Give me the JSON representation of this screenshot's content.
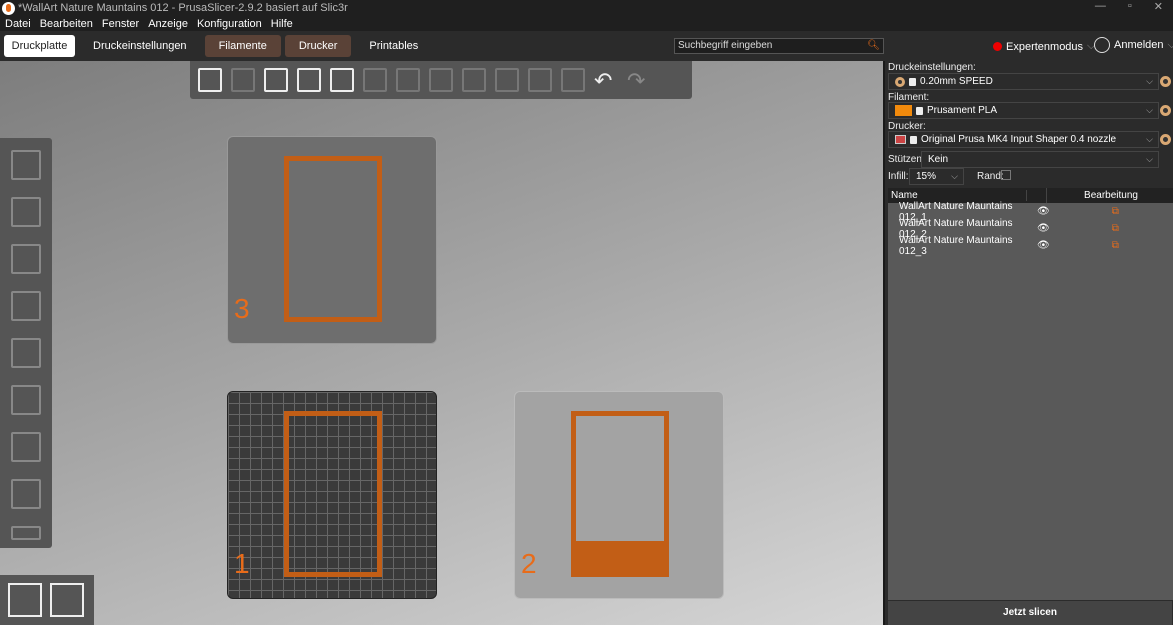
{
  "window": {
    "title": "*WallArt Nature Mauntains 012 - PrusaSlicer-2.9.2 basiert auf Slic3r"
  },
  "menu": [
    "Datei",
    "Bearbeiten",
    "Fenster",
    "Anzeige",
    "Konfiguration",
    "Hilfe"
  ],
  "tabs": [
    "Druckplatte",
    "Druckeinstellungen",
    "Filamente",
    "Drucker",
    "Printables"
  ],
  "search": {
    "placeholder": "Suchbegriff eingeben"
  },
  "mode": "Expertenmodus",
  "login": "Anmelden",
  "beds": [
    "3",
    "1",
    "2"
  ],
  "sidebar": {
    "print_label": "Druckeinstellungen:",
    "print_value": "0.20mm SPEED",
    "filament_label": "Filament:",
    "filament_value": "Prusament PLA",
    "filament_color": "#f28a0c",
    "printer_label": "Drucker:",
    "printer_value": "Original Prusa MK4 Input Shaper 0.4 nozzle",
    "supports_label": "Stützen:",
    "supports_value": "Kein",
    "infill_label": "Infill:",
    "infill_value": "15%",
    "brim_label": "Rand:",
    "brim_checked": false,
    "columns": [
      "Name",
      "Bearbeitung"
    ],
    "objects": [
      "WallArt Nature Mauntains 012_1",
      "WallArt Nature Mauntains 012_2",
      "WallArt Nature Mauntains 012_3"
    ],
    "slice_button": "Jetzt slicen"
  }
}
